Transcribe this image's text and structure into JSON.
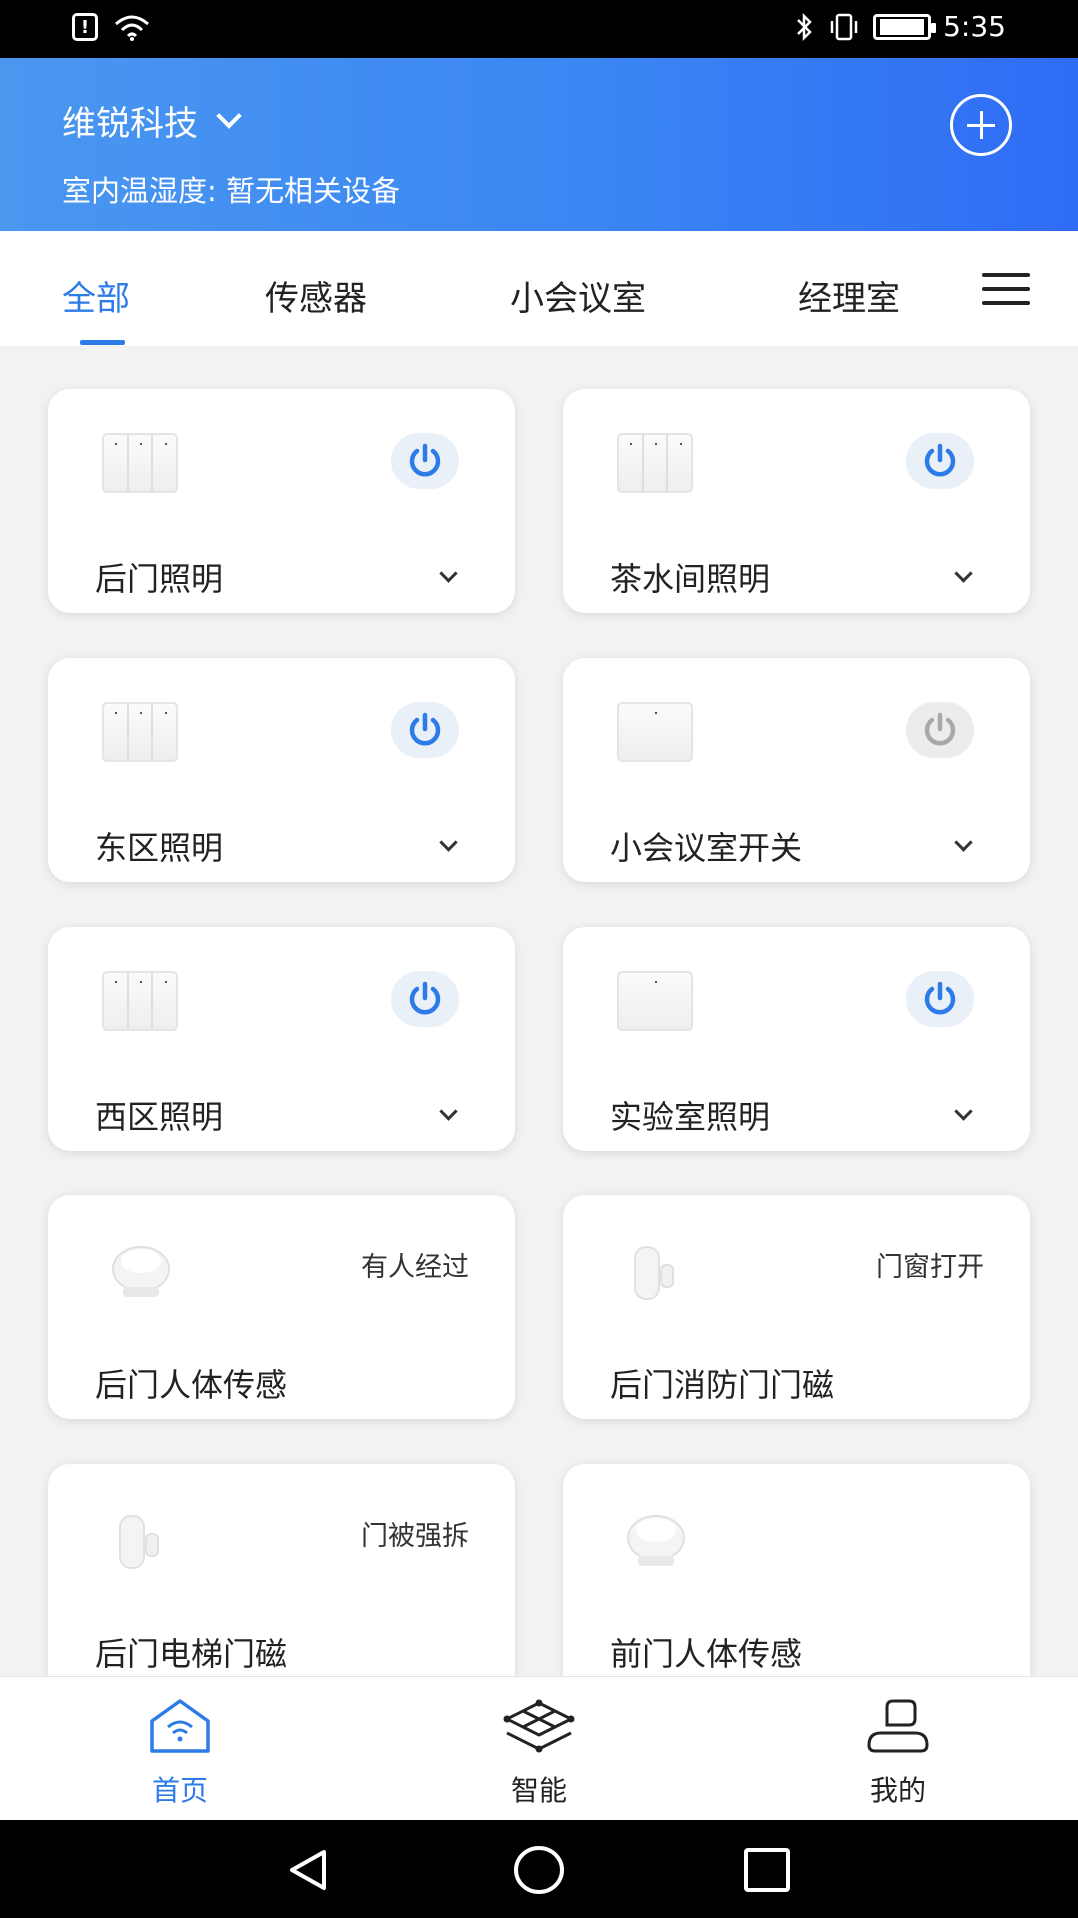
{
  "status_bar": {
    "time": "5:35"
  },
  "header": {
    "org_name": "维锐科技",
    "humidity_text": "室内温湿度: 暂无相关设备"
  },
  "tabs": [
    {
      "label": "全部",
      "active": true
    },
    {
      "label": "传感器",
      "active": false
    },
    {
      "label": "小会议室",
      "active": false
    },
    {
      "label": "经理室",
      "active": false
    }
  ],
  "devices": [
    {
      "name": "后门照明",
      "type": "three-gang-switch",
      "power": "on"
    },
    {
      "name": "茶水间照明",
      "type": "three-gang-switch",
      "power": "on"
    },
    {
      "name": "东区照明",
      "type": "three-gang-switch",
      "power": "on"
    },
    {
      "name": "小会议室开关",
      "type": "single-gang-switch",
      "power": "off"
    },
    {
      "name": "西区照明",
      "type": "three-gang-switch",
      "power": "on"
    },
    {
      "name": "实验室照明",
      "type": "single-gang-switch",
      "power": "on"
    },
    {
      "name": "后门人体传感",
      "type": "motion-sensor",
      "status": "有人经过"
    },
    {
      "name": "后门消防门门磁",
      "type": "door-sensor",
      "status": "门窗打开"
    },
    {
      "name": "后门电梯门磁",
      "type": "door-sensor",
      "status": "门被强拆"
    },
    {
      "name": "前门人体传感",
      "type": "motion-sensor",
      "status": ""
    }
  ],
  "bottom_nav": [
    {
      "label": "首页",
      "icon": "home-wifi-icon",
      "active": true
    },
    {
      "label": "智能",
      "icon": "smart-network-icon",
      "active": false
    },
    {
      "label": "我的",
      "icon": "profile-icon",
      "active": false
    }
  ],
  "colors": {
    "accent": "#2c7be8",
    "header_start": "#4a97f0",
    "header_end": "#2f6cf5"
  }
}
